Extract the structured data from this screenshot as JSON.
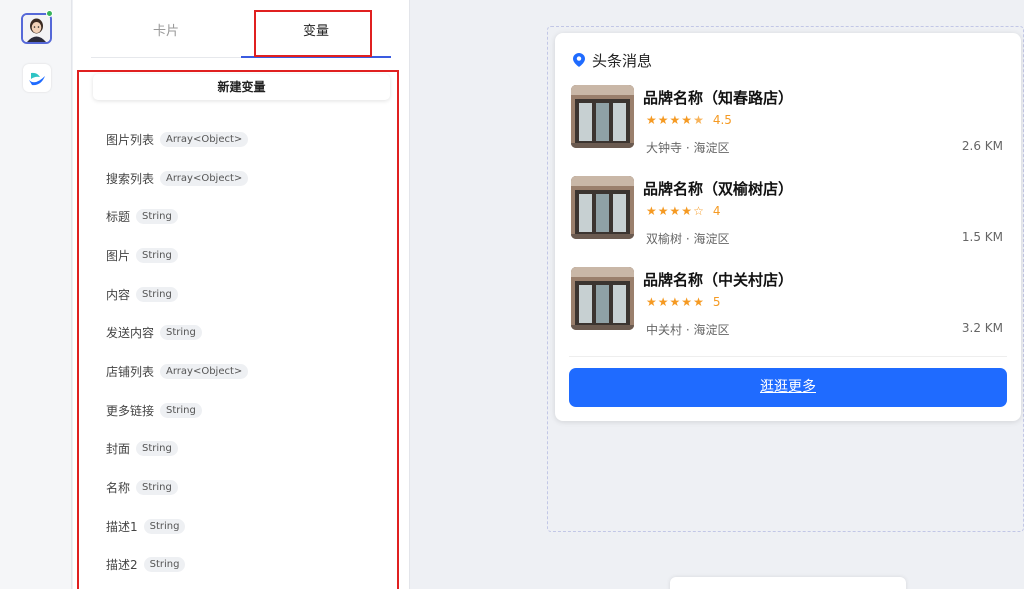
{
  "tabs": {
    "cards": "卡片",
    "variables": "变量"
  },
  "new_variable_label": "新建变量",
  "variables": [
    {
      "name": "图片列表",
      "type": "Array<Object>"
    },
    {
      "name": "搜索列表",
      "type": "Array<Object>"
    },
    {
      "name": "标题",
      "type": "String"
    },
    {
      "name": "图片",
      "type": "String"
    },
    {
      "name": "内容",
      "type": "String"
    },
    {
      "name": "发送内容",
      "type": "String"
    },
    {
      "name": "店铺列表",
      "type": "Array<Object>"
    },
    {
      "name": "更多链接",
      "type": "String"
    },
    {
      "name": "封面",
      "type": "String"
    },
    {
      "name": "名称",
      "type": "String"
    },
    {
      "name": "描述1",
      "type": "String"
    },
    {
      "name": "描述2",
      "type": "String"
    }
  ],
  "card": {
    "header": "头条消息",
    "shops": [
      {
        "name": "品牌名称（知春路店）",
        "stars": 4.5,
        "rating_label": "4.5",
        "address": "大钟寺 · 海淀区",
        "distance": "2.6 KM"
      },
      {
        "name": "品牌名称（双榆树店）",
        "stars": 4,
        "rating_label": "4",
        "address": "双榆树 · 海淀区",
        "distance": "1.5 KM"
      },
      {
        "name": "品牌名称（中关村店）",
        "stars": 5,
        "rating_label": "5",
        "address": "中关村 · 海淀区",
        "distance": "3.2 KM"
      }
    ],
    "more_button": "逛逛更多"
  },
  "colors": {
    "accent": "#1f6bff",
    "star": "#f59a23",
    "annotation": "#e02020",
    "tab_underline": "#3a5be0"
  },
  "icons": {
    "header": "location-pin-icon",
    "avatar": "user-avatar-icon",
    "app": "app-logo-icon"
  }
}
